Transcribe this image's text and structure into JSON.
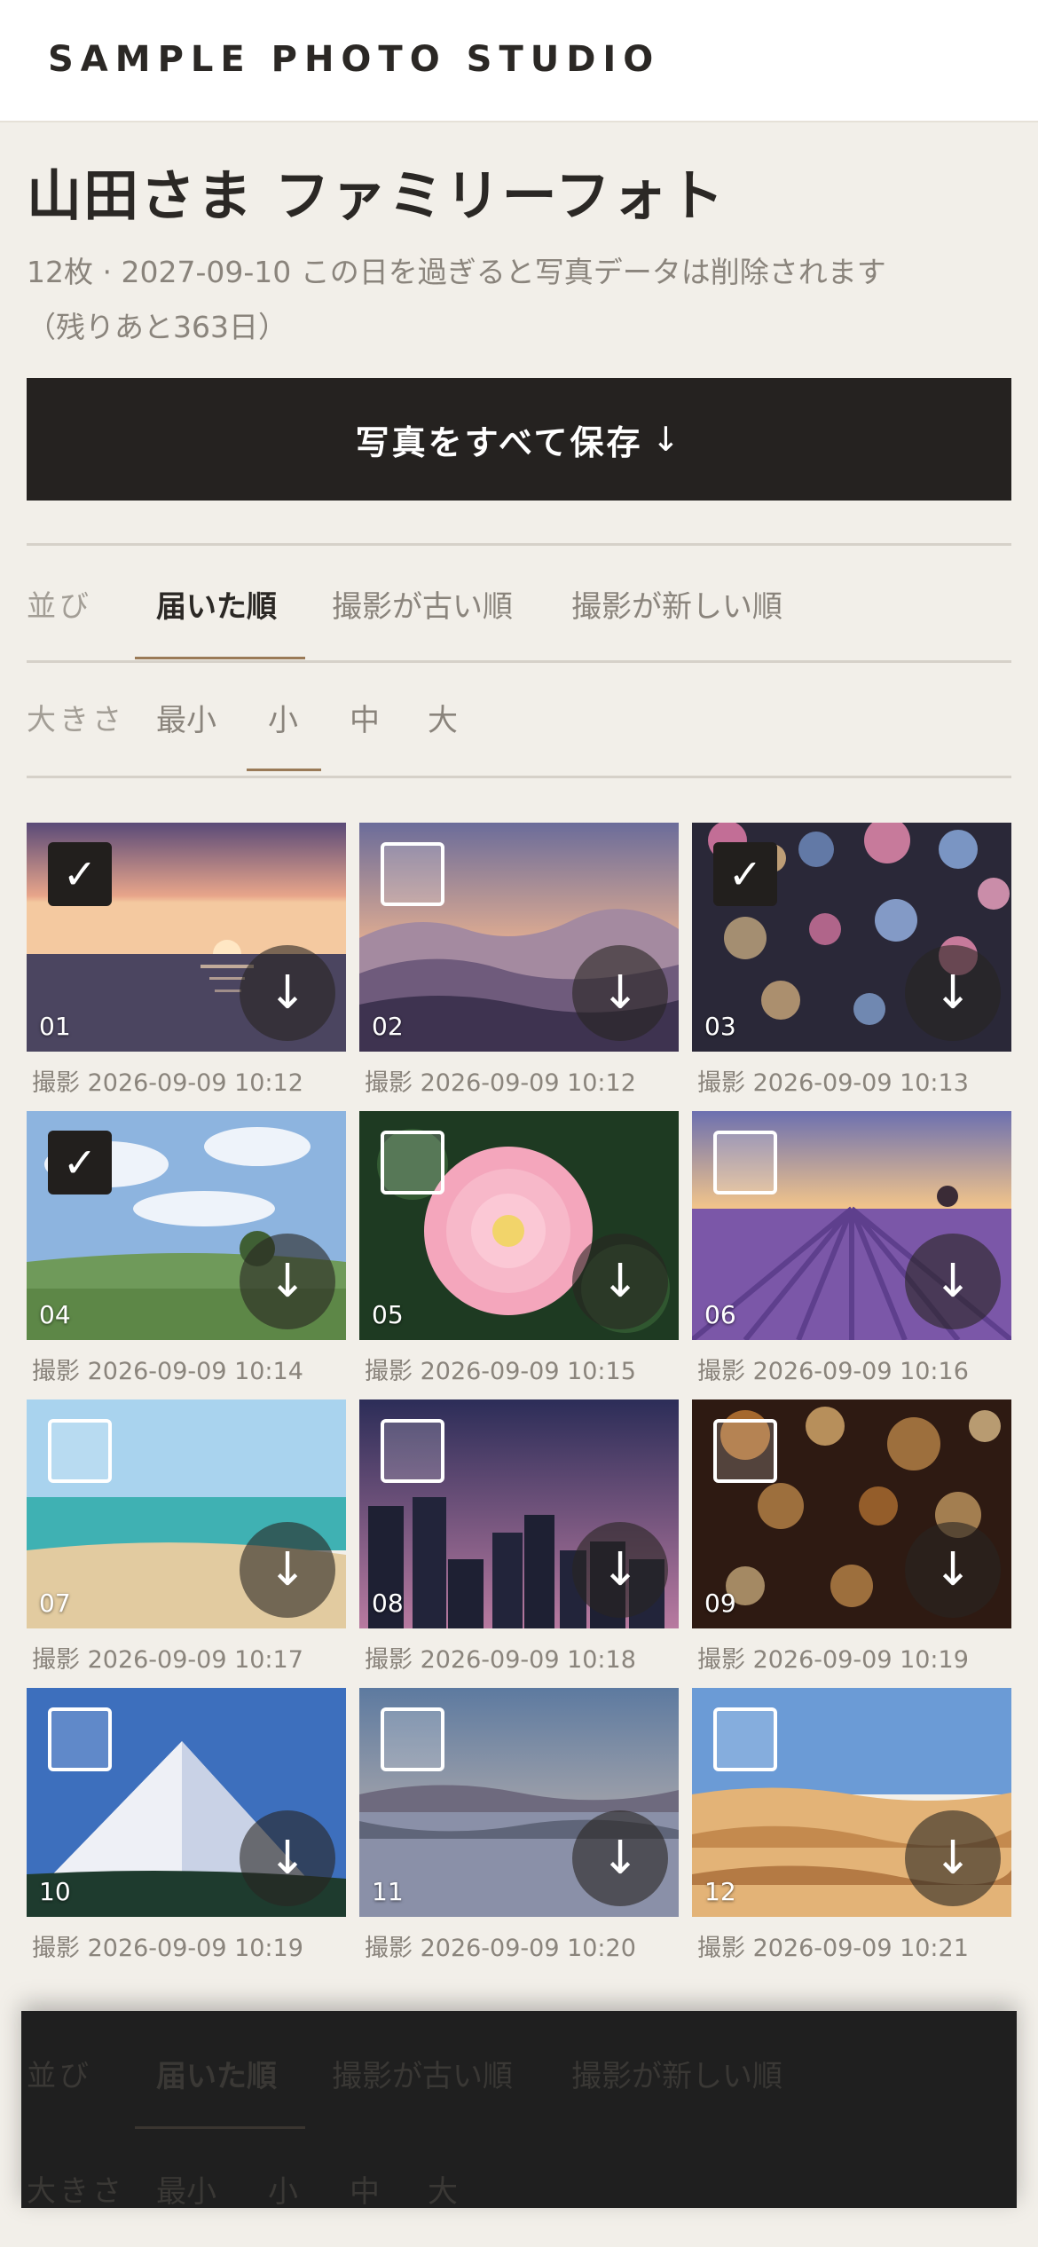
{
  "header": {
    "brand": "SAMPLE PHOTO STUDIO"
  },
  "album": {
    "title": "山田さま ファミリーフォト",
    "meta_line1": "12枚 · 2027-09-10 この日を過ぎると写真データは削除されます",
    "meta_line2": "（残りあと363日）"
  },
  "save_all": {
    "label": "写真をすべて保存",
    "icon": "↓",
    "icon_name": "download-arrow-icon"
  },
  "sort": {
    "label": "並び",
    "options": [
      "届いた順",
      "撮影が古い順",
      "撮影が新しい順"
    ],
    "selected": "届いた順"
  },
  "size": {
    "label": "大きさ",
    "options": [
      "最小",
      "小",
      "中",
      "大"
    ],
    "selected": "小"
  },
  "photos": [
    {
      "number": "01",
      "caption": "撮影 2026-09-09 10:12",
      "selected": true,
      "scene": "sunset-sea"
    },
    {
      "number": "02",
      "caption": "撮影 2026-09-09 10:12",
      "selected": false,
      "scene": "mountains"
    },
    {
      "number": "03",
      "caption": "撮影 2026-09-09 10:13",
      "selected": true,
      "scene": "bokeh-pastel"
    },
    {
      "number": "04",
      "caption": "撮影 2026-09-09 10:14",
      "selected": true,
      "scene": "meadow"
    },
    {
      "number": "05",
      "caption": "撮影 2026-09-09 10:15",
      "selected": false,
      "scene": "flower"
    },
    {
      "number": "06",
      "caption": "撮影 2026-09-09 10:16",
      "selected": false,
      "scene": "lavender"
    },
    {
      "number": "07",
      "caption": "撮影 2026-09-09 10:17",
      "selected": false,
      "scene": "beach"
    },
    {
      "number": "08",
      "caption": "撮影 2026-09-09 10:18",
      "selected": false,
      "scene": "city"
    },
    {
      "number": "09",
      "caption": "撮影 2026-09-09 10:19",
      "selected": false,
      "scene": "bokeh-warm"
    },
    {
      "number": "10",
      "caption": "撮影 2026-09-09 10:19",
      "selected": false,
      "scene": "snow-mountain"
    },
    {
      "number": "11",
      "caption": "撮影 2026-09-09 10:20",
      "selected": false,
      "scene": "lake"
    },
    {
      "number": "12",
      "caption": "撮影 2026-09-09 10:21",
      "selected": false,
      "scene": "desert"
    }
  ],
  "icons": {
    "check": "✓",
    "download": "↓"
  },
  "colors": {
    "accent": "#9a7a57",
    "button": "#252220",
    "background": "#f2efe9"
  }
}
